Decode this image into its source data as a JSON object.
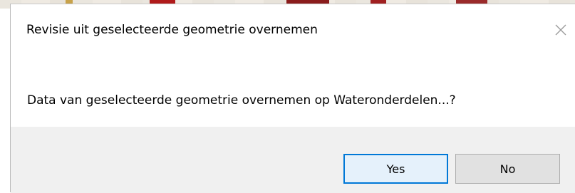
{
  "dialog": {
    "title": "Revisie uit geselecteerde geometrie overnemen",
    "message": "Data van geselecteerde geometrie overnemen op Wateronderdelen...?",
    "close_icon": "close-icon",
    "buttons": {
      "yes_label": "Yes",
      "no_label": "No"
    }
  },
  "colors": {
    "footer_background": "#f0f0f0",
    "default_button_border": "#0078d7",
    "button_background": "#e1e1e1"
  }
}
